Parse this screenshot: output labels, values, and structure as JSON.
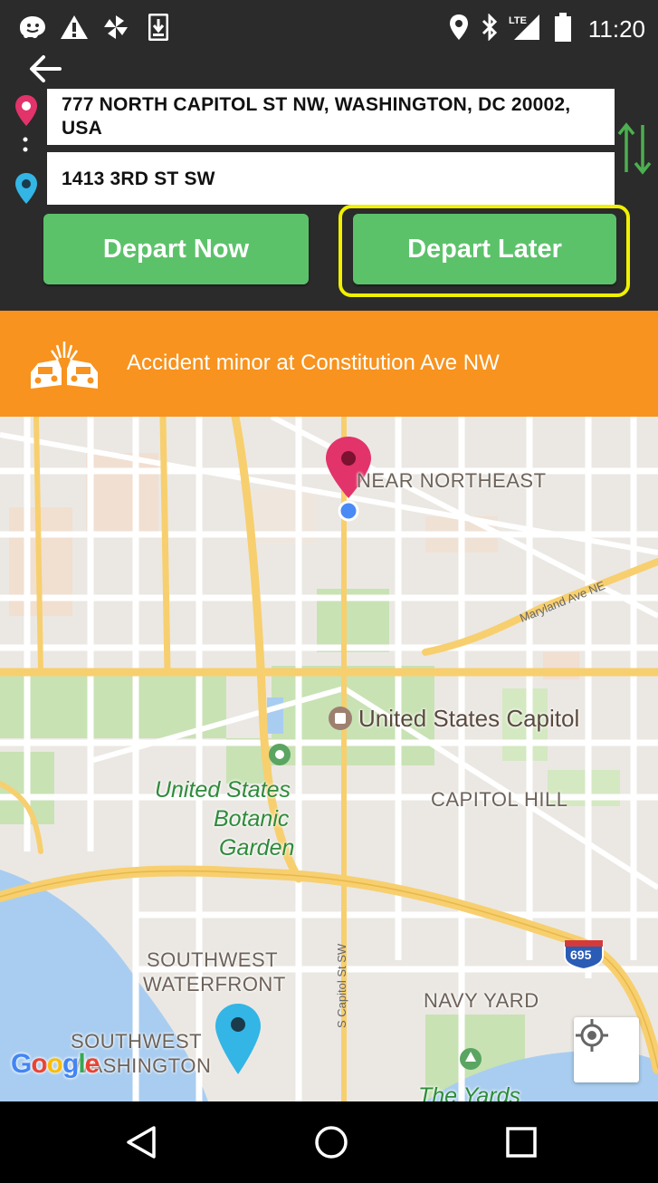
{
  "status_bar": {
    "time": "11:20",
    "network": "LTE",
    "left_icons": [
      "waze-icon",
      "warning-icon",
      "pinwheel-icon",
      "download-icon"
    ],
    "right_icons": [
      "location-icon",
      "bluetooth-icon",
      "signal-icon",
      "battery-icon"
    ]
  },
  "header": {
    "back_icon": "arrow-left-icon",
    "from_address": "777 NORTH CAPITOL ST NW, WASHINGTON, DC 20002, USA",
    "to_address": "1413 3RD ST SW",
    "swap_icon": "swap-vertical-icon",
    "depart_now_label": "Depart Now",
    "depart_later_label": "Depart Later",
    "highlight_color": "#f0f000",
    "button_color": "#5cc26a"
  },
  "alert": {
    "text": "Accident minor at Constitution Ave NW",
    "icon": "car-crash-icon",
    "color": "#f7931e"
  },
  "map": {
    "labels": {
      "near_northeast": "NEAR NORTHEAST",
      "capitol": "United States Capitol",
      "botanic_line1": "United States",
      "botanic_line2": "Botanic",
      "botanic_line3": "Garden",
      "capitol_hill": "CAPITOL HILL",
      "sw_waterfront_line1": "SOUTHWEST",
      "sw_waterfront_line2": "WATERFRONT",
      "sw_washington_line1": "SOUTHWEST",
      "sw_washington_line2": "WASHINGTON",
      "navy_yard": "NAVY YARD",
      "the_yards": "The Yards",
      "maryland_ave": "Maryland Ave NE",
      "s_capitol_st": "S Capitol St SW",
      "interstate": "695"
    },
    "google_letters": [
      "G",
      "o",
      "o",
      "g",
      "l",
      "e"
    ],
    "origin_pin_color": "#e2336b",
    "destination_pin_color": "#33b5e5"
  },
  "navbar": {
    "icons": [
      "back-triangle-icon",
      "home-circle-icon",
      "recents-square-icon"
    ]
  }
}
